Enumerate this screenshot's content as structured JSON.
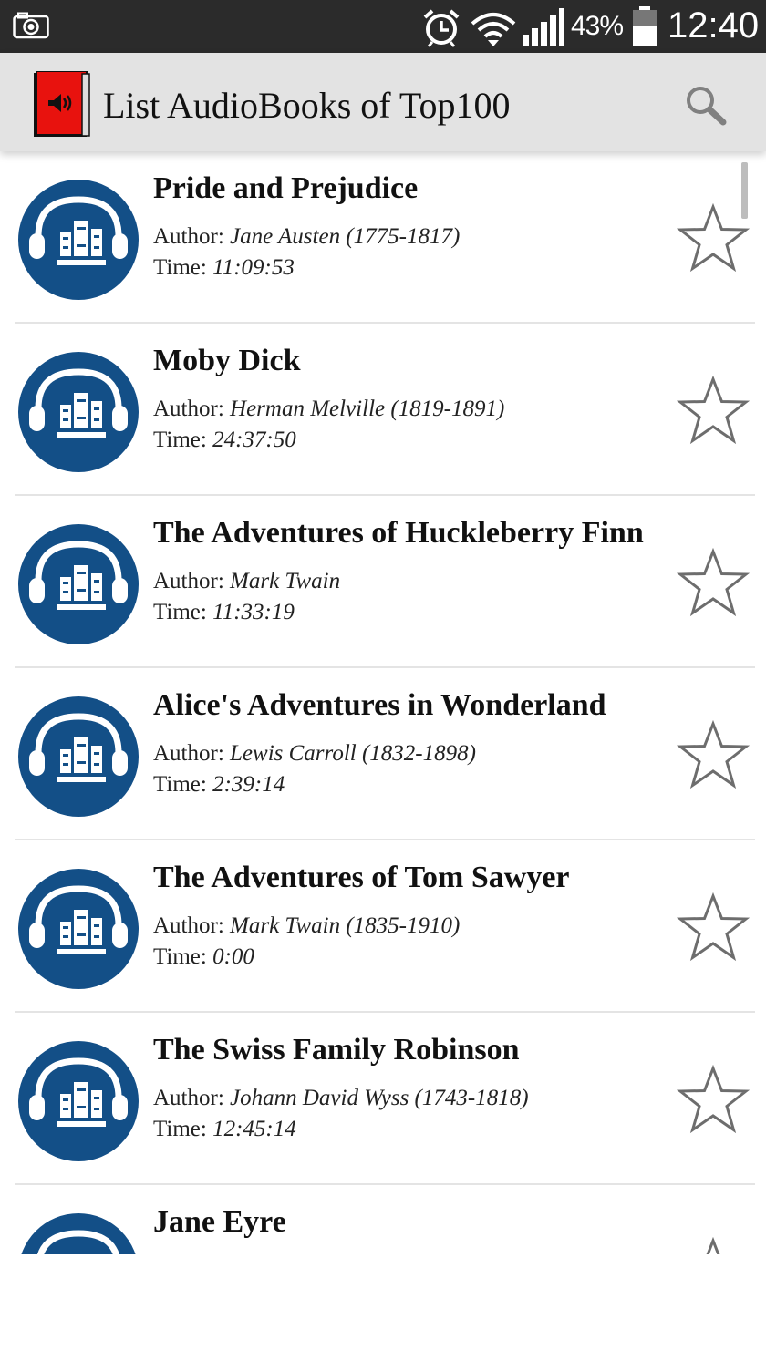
{
  "status_bar": {
    "battery_percent": "43%",
    "time": "12:40",
    "icons": [
      "camera-icon",
      "alarm-icon",
      "wifi-icon",
      "signal-icon",
      "battery-icon"
    ]
  },
  "action_bar": {
    "title": "List AudioBooks of Top100",
    "app_icon": "red-audiobook-speaker-icon",
    "search_icon": "search-icon"
  },
  "labels": {
    "author": "Author:",
    "time": "Time:"
  },
  "books": [
    {
      "title": "Pride and Prejudice",
      "author": "Jane Austen (1775-1817)",
      "time": "11:09:53"
    },
    {
      "title": "Moby Dick",
      "author": "Herman Melville (1819-1891)",
      "time": "24:37:50"
    },
    {
      "title": "The Adventures of Huckleberry Finn",
      "author": "Mark Twain",
      "time": "11:33:19"
    },
    {
      "title": "Alice's Adventures in Wonderland",
      "author": "Lewis Carroll (1832-1898)",
      "time": "2:39:14"
    },
    {
      "title": "The Adventures of Tom Sawyer",
      "author": "Mark Twain (1835-1910)",
      "time": "0:00"
    },
    {
      "title": "The Swiss Family Robinson",
      "author": "Johann David Wyss (1743-1818)",
      "time": "12:45:14"
    },
    {
      "title": "Jane Eyre",
      "author": "",
      "time": ""
    }
  ],
  "colors": {
    "cover_blue": "#134f87",
    "status_bar": "#2b2b2b",
    "action_bar": "#e3e3e3",
    "app_icon_red": "#e8120e"
  }
}
